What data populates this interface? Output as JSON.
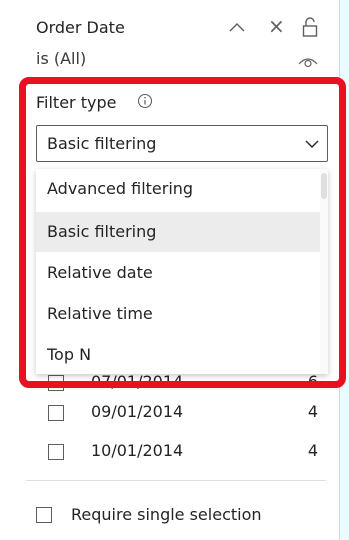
{
  "header": {
    "title": "Order Date",
    "subtitle": "is (All)"
  },
  "filter_type": {
    "label": "Filter type",
    "selected": "Basic filtering"
  },
  "dropdown": {
    "options": [
      {
        "label": "Advanced filtering",
        "selected": false
      },
      {
        "label": "Basic filtering",
        "selected": true
      },
      {
        "label": "Relative date",
        "selected": false
      },
      {
        "label": "Relative time",
        "selected": false
      },
      {
        "label": "Top N",
        "selected": false
      }
    ]
  },
  "values": [
    {
      "label": "07/01/2014",
      "count": "6",
      "checked": false
    },
    {
      "label": "09/01/2014",
      "count": "4",
      "checked": false
    },
    {
      "label": "10/01/2014",
      "count": "4",
      "checked": false
    }
  ],
  "require_single": {
    "label": "Require single selection",
    "checked": false
  },
  "colors": {
    "highlight": "#e81123",
    "accent_strip": "#e9fbfd",
    "selected_option": "#ececec"
  },
  "icons": {
    "collapse": "chevron-up-icon",
    "clear": "close-icon",
    "lock": "lock-icon",
    "visibility": "eye-icon",
    "info": "info-icon",
    "expand": "chevron-down-icon"
  }
}
